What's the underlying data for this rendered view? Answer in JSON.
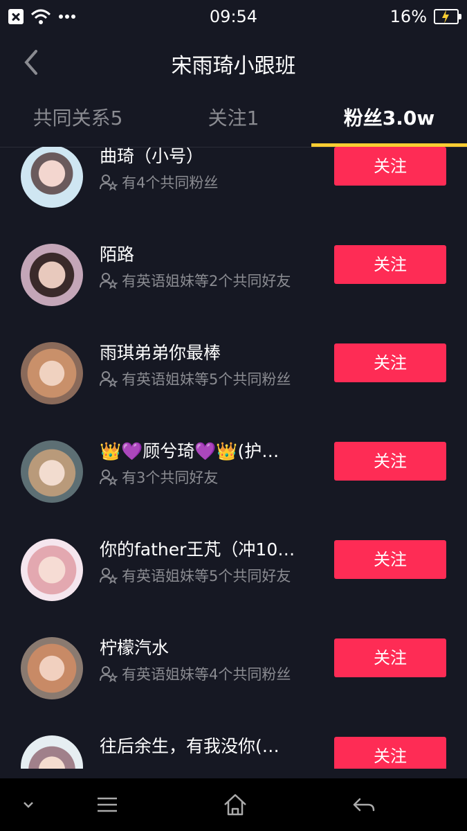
{
  "status_bar": {
    "time": "09:54",
    "battery": "16%"
  },
  "header": {
    "title": "宋雨琦小跟班"
  },
  "tabs": [
    {
      "label": "共同关系5"
    },
    {
      "label": "关注1"
    },
    {
      "label": "粉丝3.0w"
    }
  ],
  "accent": "#facd32",
  "follow_color": "#fe2c55",
  "users": [
    {
      "name": "曲琦（小号）",
      "sub": "有4个共同粉丝",
      "button": "关注"
    },
    {
      "name": "陌路",
      "sub": "有英语姐妹等2个共同好友",
      "button": "关注"
    },
    {
      "name": "雨琪弟弟你最棒",
      "sub": "有英语姐妹等5个共同粉丝",
      "button": "关注"
    },
    {
      "name": "👑💜顾兮琦💜👑(护…",
      "sub": "有3个共同好友",
      "button": "关注"
    },
    {
      "name": "你的father王芃（冲10…",
      "sub": "有英语姐妹等5个共同好友",
      "button": "关注"
    },
    {
      "name": "柠檬汽水",
      "sub": "有英语姐妹等4个共同粉丝",
      "button": "关注"
    },
    {
      "name": "往后余生，有我没你(…",
      "sub": "",
      "button": "关注"
    }
  ],
  "icons": {
    "back": "chevron-left-icon",
    "friends": "mutual-friends-icon",
    "nav": [
      "chevron-down-icon",
      "menu-icon",
      "home-icon",
      "back-arrow-icon"
    ]
  }
}
